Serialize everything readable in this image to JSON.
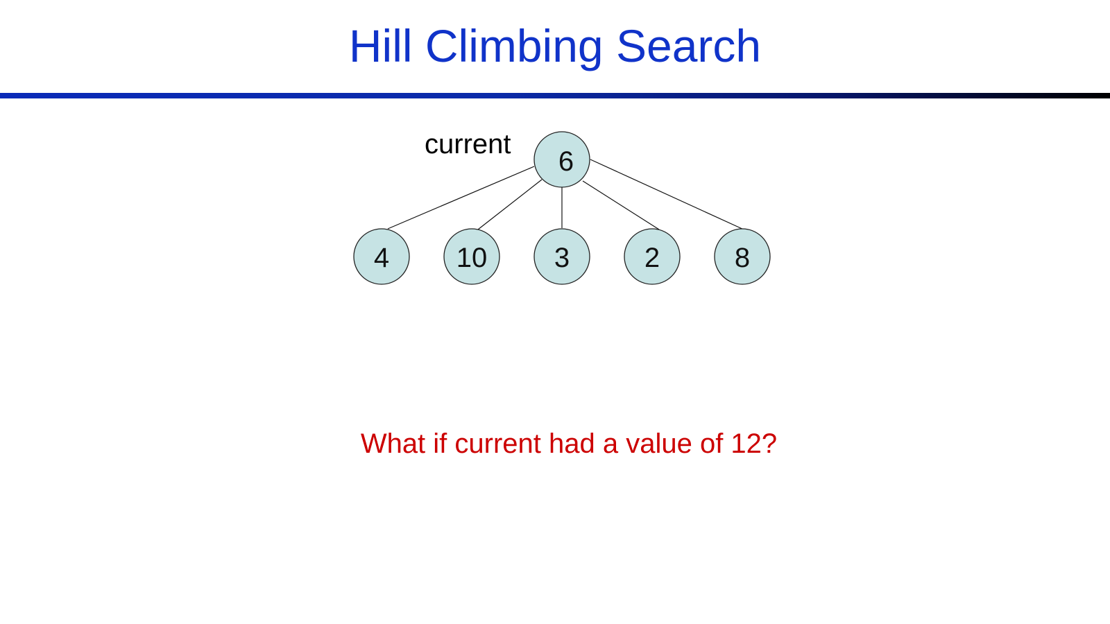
{
  "slide": {
    "title": "Hill Climbing Search",
    "title_color": "#1033c9",
    "question": "What if current had a value of 12?",
    "question_color": "#cc0000"
  },
  "tree": {
    "current_label": "current",
    "node_fill_color": "#c6e3e4",
    "root": {
      "value": "6"
    },
    "children": [
      {
        "value": "4"
      },
      {
        "value": "10"
      },
      {
        "value": "3"
      },
      {
        "value": "2"
      },
      {
        "value": "8"
      }
    ]
  }
}
